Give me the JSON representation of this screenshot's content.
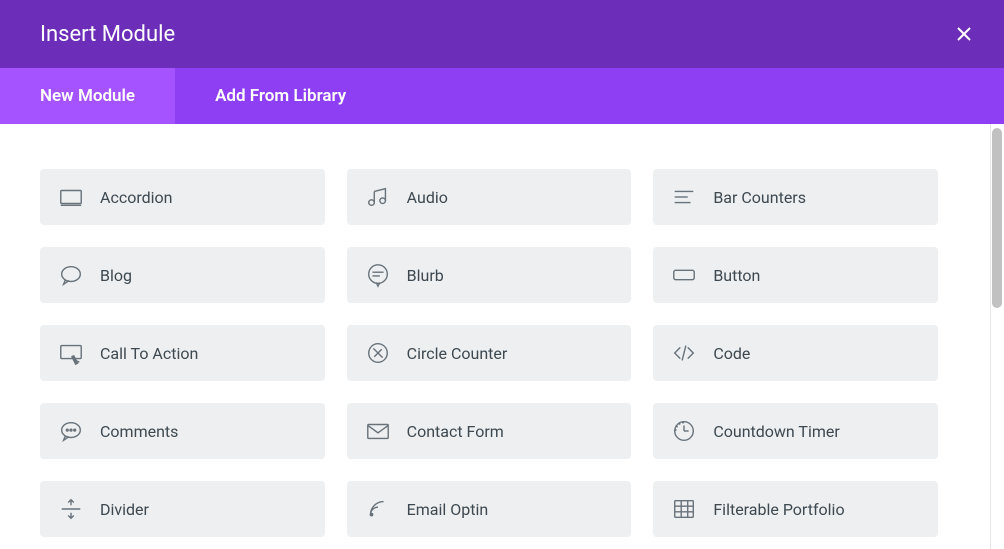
{
  "header": {
    "title": "Insert Module"
  },
  "tabs": [
    {
      "label": "New Module",
      "active": true
    },
    {
      "label": "Add From Library",
      "active": false
    }
  ],
  "modules": [
    {
      "icon": "accordion",
      "label": "Accordion"
    },
    {
      "icon": "audio",
      "label": "Audio"
    },
    {
      "icon": "bar-counters",
      "label": "Bar Counters"
    },
    {
      "icon": "blog",
      "label": "Blog"
    },
    {
      "icon": "blurb",
      "label": "Blurb"
    },
    {
      "icon": "button",
      "label": "Button"
    },
    {
      "icon": "call-to-action",
      "label": "Call To Action"
    },
    {
      "icon": "circle-counter",
      "label": "Circle Counter"
    },
    {
      "icon": "code",
      "label": "Code"
    },
    {
      "icon": "comments",
      "label": "Comments"
    },
    {
      "icon": "contact-form",
      "label": "Contact Form"
    },
    {
      "icon": "countdown-timer",
      "label": "Countdown Timer"
    },
    {
      "icon": "divider",
      "label": "Divider"
    },
    {
      "icon": "email-optin",
      "label": "Email Optin"
    },
    {
      "icon": "filterable-portfolio",
      "label": "Filterable Portfolio"
    }
  ]
}
